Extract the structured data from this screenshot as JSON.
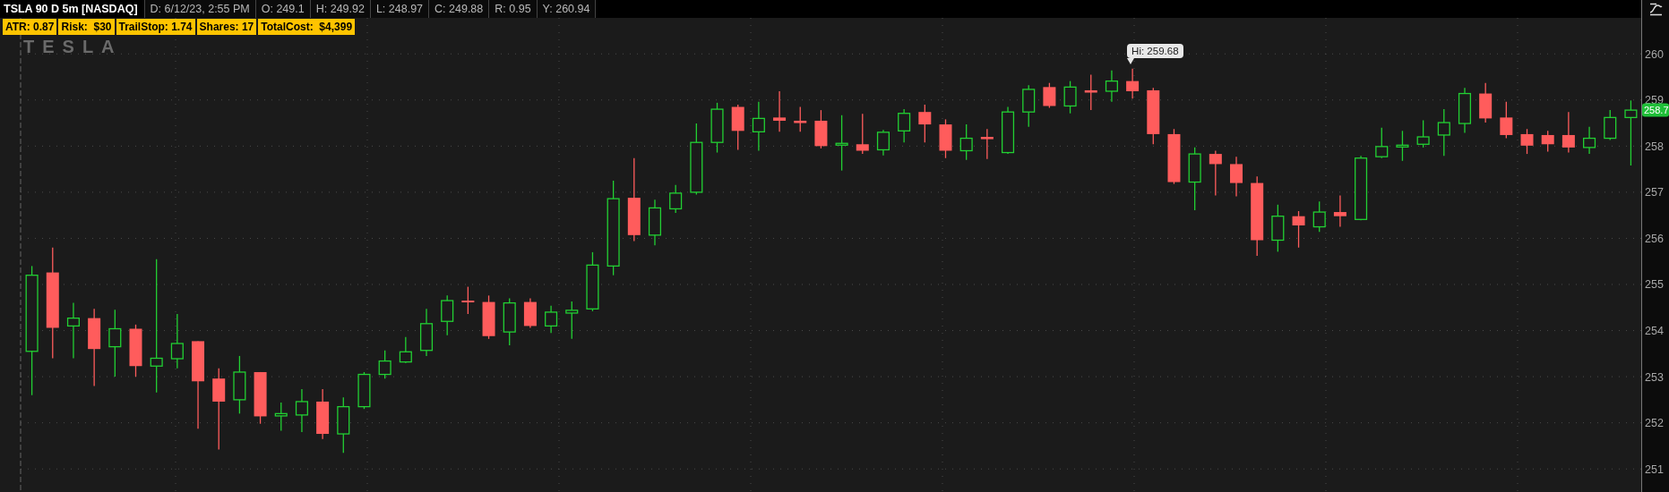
{
  "header": {
    "symbol": "TSLA 90 D 5m [NASDAQ]",
    "fields": [
      "D: 6/12/23, 2:55 PM",
      "O: 249.1",
      "H: 249.92",
      "L: 248.97",
      "C: 249.88",
      "R: 0.95",
      "Y: 260.94"
    ]
  },
  "studies": [
    "ATR: 0.87",
    "Risk:  $30",
    "TrailStop: 1.74",
    "Shares: 17",
    "TotalCost:  $4,399"
  ],
  "chart": {
    "logo": "TESLA",
    "tooltip": "Hi: 259.68",
    "last_price": "258.7",
    "chart_data": {
      "type": "candlestick",
      "grid": true,
      "categories": [
        null,
        null,
        null,
        null,
        null,
        null,
        null,
        null,
        null,
        null,
        null,
        null,
        null,
        null,
        null,
        null,
        null,
        null,
        null,
        null,
        null,
        null,
        null,
        null,
        null,
        null,
        null,
        null,
        null,
        null,
        null,
        null,
        null,
        null,
        null,
        null,
        null,
        null,
        null,
        null,
        null,
        null,
        null,
        null,
        null,
        null,
        null,
        null,
        null,
        null,
        null,
        null,
        null,
        null,
        null,
        null,
        null,
        null,
        null,
        null,
        null,
        null,
        null,
        null,
        null,
        null,
        null,
        null,
        null,
        null,
        null,
        null,
        null,
        null,
        null,
        null,
        null,
        null
      ],
      "ylim": [
        250.5,
        260.78
      ],
      "yticks": [
        251,
        252,
        253,
        254,
        255,
        256,
        257,
        258,
        259,
        260
      ],
      "ohlc": [
        [
          253.55,
          255.4,
          252.6,
          255.2
        ],
        [
          255.26,
          255.8,
          253.4,
          254.06
        ],
        [
          254.1,
          254.6,
          253.4,
          254.27
        ],
        [
          254.27,
          254.47,
          252.8,
          253.6
        ],
        [
          253.65,
          254.45,
          253.0,
          254.04
        ],
        [
          254.04,
          254.13,
          253.0,
          253.23
        ],
        [
          253.23,
          255.55,
          252.66,
          253.4
        ],
        [
          253.39,
          254.36,
          253.18,
          253.72
        ],
        [
          253.77,
          253.77,
          251.87,
          252.9
        ],
        [
          252.96,
          253.18,
          251.42,
          252.46
        ],
        [
          252.5,
          253.45,
          252.2,
          253.1
        ],
        [
          253.1,
          253.1,
          251.98,
          252.14
        ],
        [
          252.15,
          252.44,
          251.83,
          252.2
        ],
        [
          252.17,
          252.73,
          251.8,
          252.46
        ],
        [
          252.46,
          252.73,
          251.65,
          251.76
        ],
        [
          251.76,
          252.55,
          251.35,
          252.35
        ],
        [
          252.35,
          253.1,
          252.3,
          253.05
        ],
        [
          253.05,
          253.57,
          252.96,
          253.34
        ],
        [
          253.32,
          253.86,
          253.3,
          253.54
        ],
        [
          253.57,
          254.47,
          253.45,
          254.15
        ],
        [
          254.2,
          254.76,
          253.9,
          254.65
        ],
        [
          254.65,
          254.95,
          254.36,
          254.62
        ],
        [
          254.62,
          254.76,
          253.82,
          253.88
        ],
        [
          253.97,
          254.7,
          253.68,
          254.6
        ],
        [
          254.62,
          254.7,
          254.06,
          254.1
        ],
        [
          254.1,
          254.54,
          253.95,
          254.4
        ],
        [
          254.38,
          254.63,
          253.82,
          254.44
        ],
        [
          254.47,
          255.7,
          254.42,
          255.42
        ],
        [
          255.4,
          257.25,
          255.2,
          256.86
        ],
        [
          256.88,
          257.74,
          255.94,
          256.07
        ],
        [
          256.07,
          256.84,
          255.85,
          256.66
        ],
        [
          256.64,
          257.16,
          256.55,
          256.98
        ],
        [
          257.0,
          258.49,
          256.95,
          258.08
        ],
        [
          258.08,
          258.94,
          257.86,
          258.8
        ],
        [
          258.85,
          258.9,
          257.92,
          258.33
        ],
        [
          258.31,
          258.96,
          257.9,
          258.6
        ],
        [
          258.62,
          259.19,
          258.31,
          258.55
        ],
        [
          258.55,
          258.85,
          258.31,
          258.5
        ],
        [
          258.55,
          258.78,
          257.95,
          258.0
        ],
        [
          258.04,
          258.67,
          257.47,
          258.06
        ],
        [
          258.04,
          258.7,
          257.83,
          257.9
        ],
        [
          257.92,
          258.35,
          257.8,
          258.3
        ],
        [
          258.33,
          258.8,
          258.08,
          258.71
        ],
        [
          258.74,
          258.9,
          258.08,
          258.47
        ],
        [
          258.47,
          258.58,
          257.74,
          257.9
        ],
        [
          257.9,
          258.47,
          257.7,
          258.17
        ],
        [
          258.2,
          258.37,
          257.72,
          258.15
        ],
        [
          257.86,
          258.85,
          257.83,
          258.74
        ],
        [
          258.74,
          259.32,
          258.42,
          259.23
        ],
        [
          259.28,
          259.37,
          258.83,
          258.87
        ],
        [
          258.87,
          259.41,
          258.71,
          259.28
        ],
        [
          259.21,
          259.55,
          258.78,
          259.16
        ],
        [
          259.19,
          259.64,
          258.96,
          259.41
        ],
        [
          259.41,
          259.68,
          259.03,
          259.19
        ],
        [
          259.21,
          259.26,
          258.04,
          258.26
        ],
        [
          258.26,
          258.37,
          257.18,
          257.22
        ],
        [
          257.22,
          257.97,
          256.61,
          257.83
        ],
        [
          257.83,
          257.9,
          256.93,
          257.61
        ],
        [
          257.61,
          257.77,
          256.91,
          257.2
        ],
        [
          257.2,
          257.34,
          255.62,
          255.96
        ],
        [
          255.96,
          256.73,
          255.71,
          256.48
        ],
        [
          256.48,
          256.59,
          255.8,
          256.28
        ],
        [
          256.25,
          256.8,
          256.14,
          256.57
        ],
        [
          256.57,
          256.93,
          256.25,
          256.48
        ],
        [
          256.41,
          257.79,
          256.39,
          257.74
        ],
        [
          257.77,
          258.4,
          257.74,
          257.99
        ],
        [
          258.0,
          258.33,
          257.68,
          258.02
        ],
        [
          258.04,
          258.56,
          257.97,
          258.2
        ],
        [
          258.24,
          258.8,
          257.79,
          258.51
        ],
        [
          258.49,
          259.26,
          258.29,
          259.14
        ],
        [
          259.14,
          259.37,
          258.51,
          258.6
        ],
        [
          258.62,
          258.96,
          258.17,
          258.24
        ],
        [
          258.26,
          258.37,
          257.83,
          258.01
        ],
        [
          258.24,
          258.33,
          257.88,
          258.04
        ],
        [
          258.24,
          258.74,
          257.86,
          257.97
        ],
        [
          257.97,
          258.42,
          257.83,
          258.17
        ],
        [
          258.17,
          258.78,
          258.13,
          258.62
        ],
        [
          258.62,
          258.99,
          257.58,
          258.78
        ]
      ]
    }
  }
}
